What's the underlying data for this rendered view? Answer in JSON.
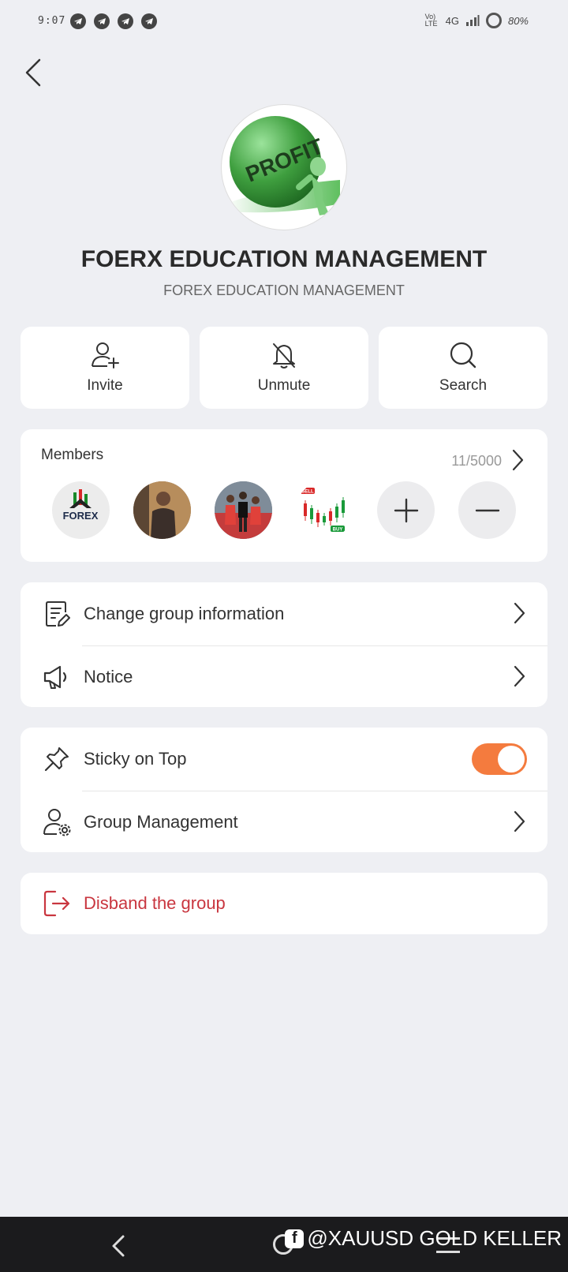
{
  "status": {
    "time": "9:07",
    "network": "4G",
    "battery": "80%",
    "lte": "Vo) LTE"
  },
  "group": {
    "title": "FOERX EDUCATION MANAGEMENT",
    "subtitle": "FOREX EDUCATION MANAGEMENT",
    "avatar_text": "PROFIT"
  },
  "actions": [
    {
      "label": "Invite",
      "icon": "add-user-icon"
    },
    {
      "label": "Unmute",
      "icon": "bell-off-icon"
    },
    {
      "label": "Search",
      "icon": "search-icon"
    }
  ],
  "members": {
    "title": "Members",
    "count": "11/5000",
    "avatars": [
      {
        "label": "FOREX"
      },
      {
        "label": ""
      },
      {
        "label": ""
      },
      {
        "sell": "SELL",
        "buy": "BUY"
      }
    ]
  },
  "settings_group1": [
    {
      "label": "Change group information",
      "icon": "edit-document-icon"
    },
    {
      "label": "Notice",
      "icon": "megaphone-icon"
    }
  ],
  "settings_group2": [
    {
      "label": "Sticky on Top",
      "icon": "pin-icon",
      "toggle": true
    },
    {
      "label": "Group Management",
      "icon": "user-gear-icon"
    }
  ],
  "disband": {
    "label": "Disband the group",
    "color": "#c9363f"
  },
  "colors": {
    "accent": "#f47b3e",
    "danger": "#c9363f"
  },
  "watermark": "@XAUUSD GOLD KELLER"
}
